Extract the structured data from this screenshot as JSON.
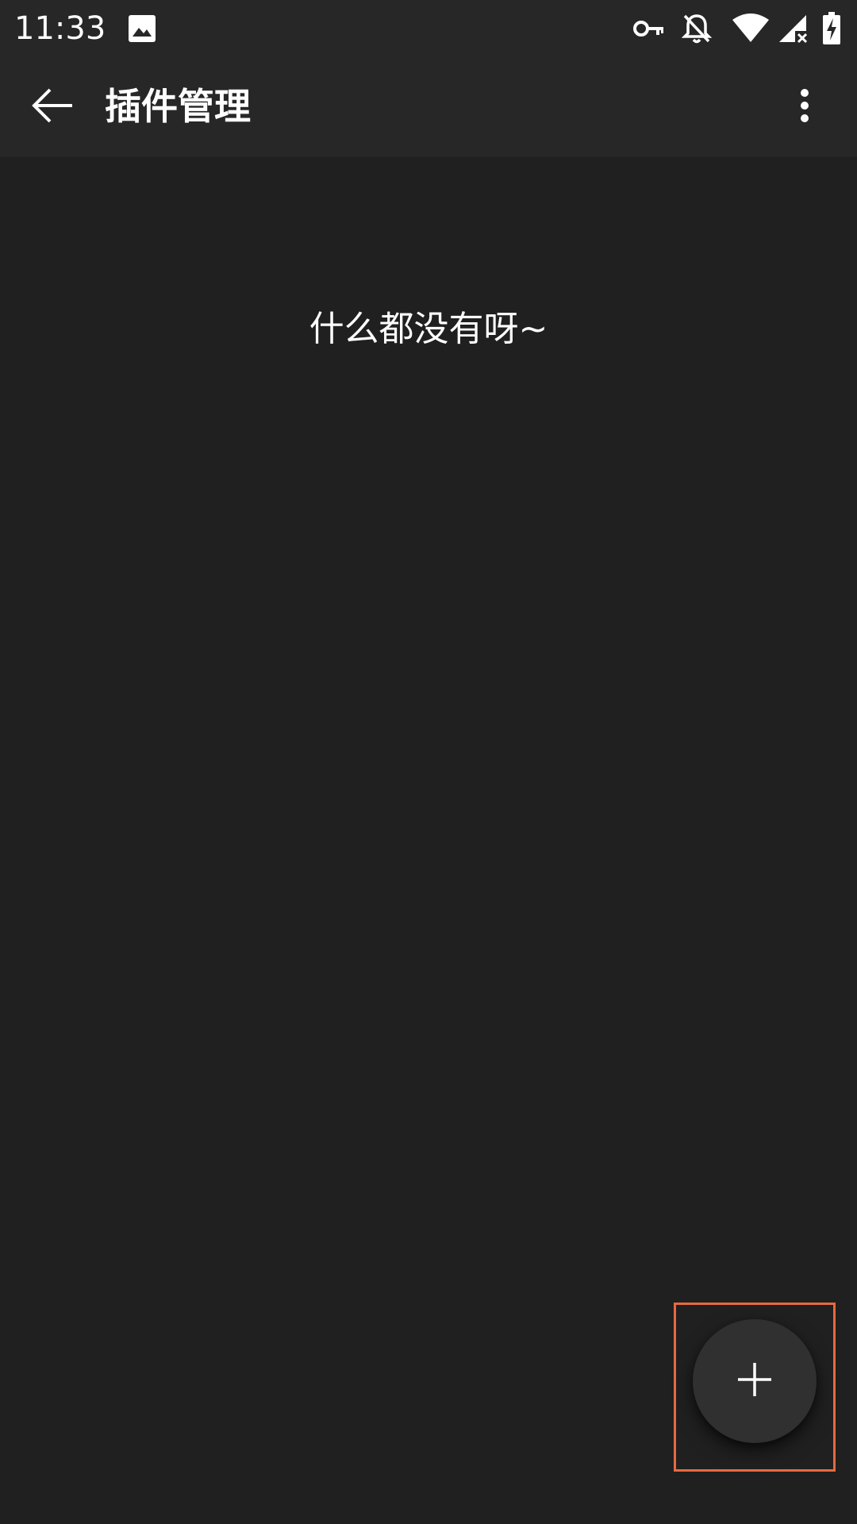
{
  "status_bar": {
    "time": "11:33",
    "icons": [
      "image-icon",
      "vpn-key-icon",
      "notifications-off-icon",
      "wifi-icon",
      "signal-no-data-icon",
      "battery-charging-icon"
    ]
  },
  "app_bar": {
    "back_icon": "arrow-back-icon",
    "title": "插件管理",
    "menu_icon": "more-vert-icon"
  },
  "empty_state": {
    "message": "什么都没有呀~"
  },
  "fab": {
    "icon": "plus-icon"
  },
  "colors": {
    "background": "#202020",
    "app_bar": "#272727",
    "fab": "#303030",
    "highlight": "#e8693f",
    "text": "#ffffff"
  }
}
